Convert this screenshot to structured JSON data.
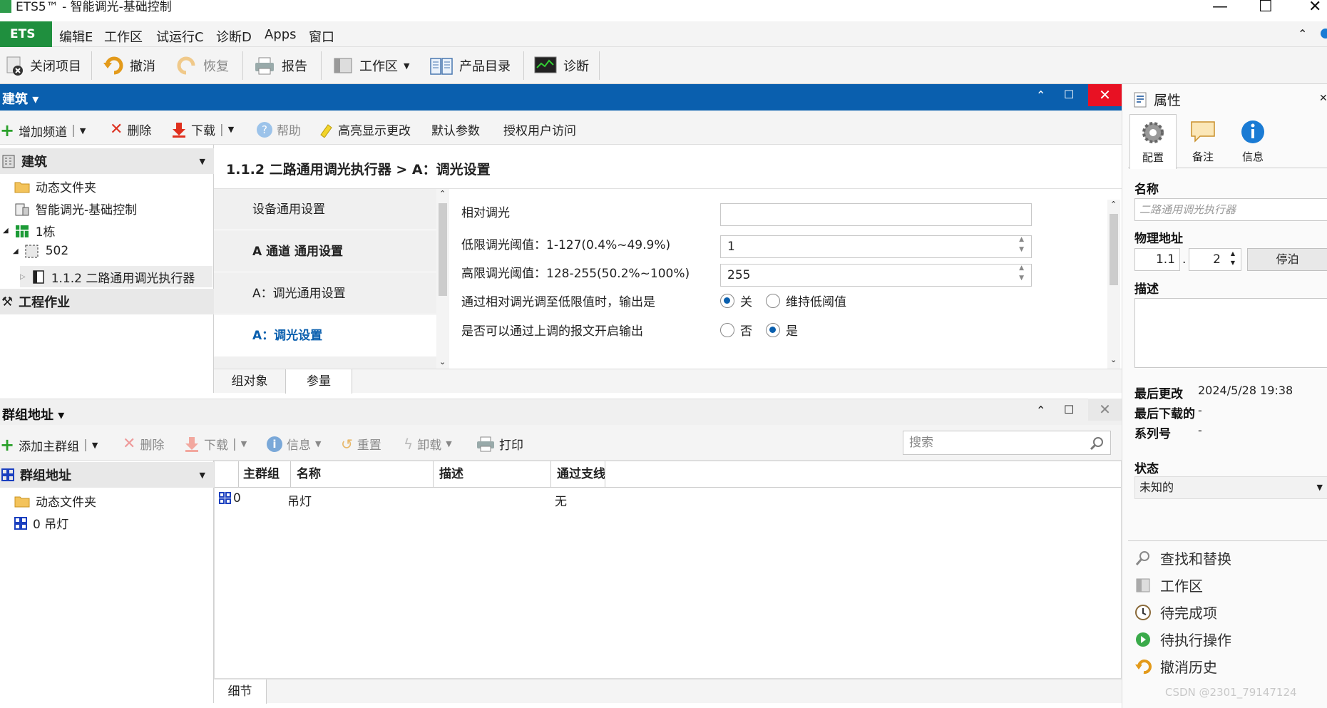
{
  "window": {
    "title": "ETS5™ - 智能调光-基础控制",
    "minimize": "—",
    "maximize": "☐",
    "close": "✕"
  },
  "menu": {
    "ets_label": "ETS",
    "items": [
      "编辑E",
      "工作区",
      "试运行C",
      "诊断D",
      "Apps",
      "窗口"
    ]
  },
  "toolbar": {
    "close_project": "关闭项目",
    "undo": "撤消",
    "redo": "恢复",
    "report": "报告",
    "workspace": "工作区",
    "catalog": "产品目录",
    "diagnostics": "诊断"
  },
  "building_panel": {
    "title": "建筑",
    "tools": {
      "add_channel": "增加频道",
      "delete": "删除",
      "download": "下载",
      "help": "帮助",
      "highlight": "高亮显示更改",
      "default_params": "默认参数",
      "authorize": "授权用户访问"
    },
    "tree": {
      "header": "建筑",
      "dynamic_folder": "动态文件夹",
      "project": "智能调光-基础控制",
      "building": "1栋",
      "room": "502",
      "device": "1.1.2 二路通用调光执行器",
      "work_header": "工程作业"
    },
    "breadcrumb": "1.1.2 二路通用调光执行器 > A：调光设置",
    "nav": [
      "设备通用设置",
      "A 通道 通用设置",
      "A：调光通用设置",
      "A：调光设置"
    ],
    "params": {
      "relative_dimming": "相对调光",
      "relative_value": "",
      "low_label": "低限调光阈值：1-127(0.4%~49.9%)",
      "low_value": "1",
      "high_label": "高限调光阈值：128-255(50.2%~100%)",
      "high_value": "255",
      "output_label": "通过相对调光调至低限值时，输出是",
      "output_opt1": "关",
      "output_opt2": "维持低阈值",
      "output_selected": "关",
      "enable_label": "是否可以通过上调的报文开启输出",
      "enable_opt1": "否",
      "enable_opt2": "是",
      "enable_selected": "是"
    },
    "tabs": [
      "组对象",
      "参量"
    ]
  },
  "group_panel": {
    "title": "群组地址",
    "tools": {
      "add_main": "添加主群组",
      "delete": "删除",
      "download": "下载",
      "info": "信息",
      "reset": "重置",
      "unload": "卸载",
      "print": "打印"
    },
    "search_placeholder": "搜索",
    "tree": {
      "header": "群组地址",
      "dynamic_folder": "动态文件夹",
      "item": "0 吊灯"
    },
    "columns": [
      "主群组",
      "名称",
      "描述",
      "通过支线耦"
    ],
    "rows": [
      {
        "main": "0",
        "name": "吊灯",
        "desc": "",
        "pass": "无"
      }
    ],
    "tabs": [
      "细节"
    ]
  },
  "properties": {
    "title": "属性",
    "tabs": [
      "配置",
      "备注",
      "信息"
    ],
    "name_label": "名称",
    "name_placeholder": "二路通用调光执行器",
    "phys_label": "物理地址",
    "phys_area": "1.1",
    "phys_dot": ".",
    "phys_device": "2",
    "park_button": "停泊",
    "desc_label": "描述",
    "last_modified_label": "最后更改",
    "last_modified_value": "2024/5/28 19:38",
    "last_download_label": "最后下载的",
    "last_download_value": "-",
    "serial_label": "系列号",
    "serial_value": "-",
    "status_label": "状态",
    "status_value": "未知的",
    "side_items": [
      "查找和替换",
      "工作区",
      "待完成项",
      "待执行操作",
      "撤消历史"
    ]
  },
  "watermark": "CSDN @2301_79147124"
}
